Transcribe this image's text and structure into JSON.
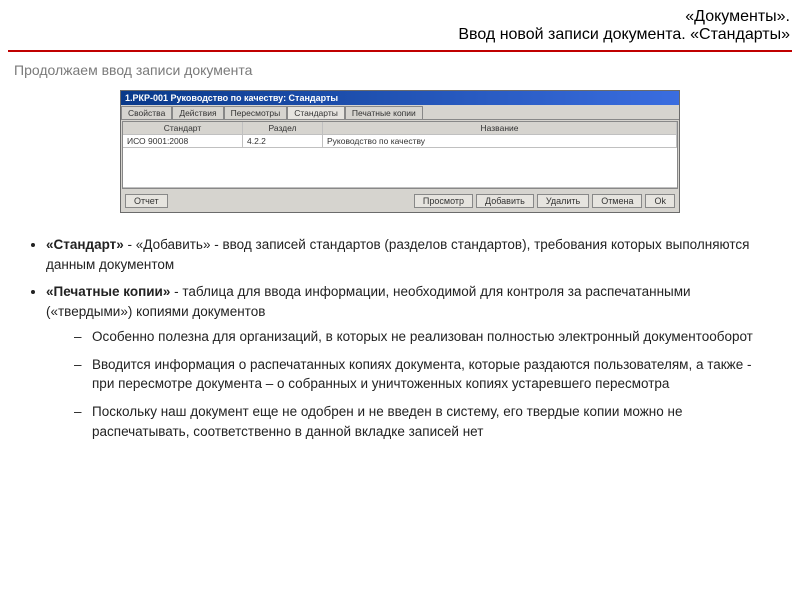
{
  "header": {
    "line1": "«Документы».",
    "line2": "Ввод новой записи документа. «Стандарты»"
  },
  "subtitle": "Продолжаем ввод записи документа",
  "window": {
    "title": "1.РКР-001 Руководство по качеству: Стандарты",
    "tabs": [
      "Свойства",
      "Действия",
      "Пересмотры",
      "Стандарты",
      "Печатные копии"
    ],
    "activeTab": 3,
    "columns": [
      "Стандарт",
      "Раздел",
      "Название"
    ],
    "row": {
      "standard": "ИСО 9001:2008",
      "section": "4.2.2",
      "name": "Руководство по качеству"
    },
    "btnLeft": "Отчет",
    "btnsRight": [
      "Просмотр",
      "Добавить",
      "Удалить",
      "Отмена",
      "Ok"
    ]
  },
  "body": {
    "p1_bold": "«Стандарт»",
    "p1_rest": " - «Добавить» - ввод записей стандартов (разделов стандартов), требования которых выполняются данным документом",
    "p2_bold": "«Печатные копии»",
    "p2_rest": " - таблица для ввода информации, необходимой для контроля за распечатанными («твердыми») копиями документов",
    "sub1": "Особенно полезна для организаций, в которых не реализован полностью электронный документооборот",
    "sub2": "Вводится информация о распечатанных копиях документа, которые раздаются пользователям, а также  - при пересмотре документа – о собранных и уничтоженных копиях устаревшего пересмотра",
    "sub3": "Поскольку наш документ еще не одобрен и не введен в систему, его твердые копии можно не распечатывать, соответственно в данной вкладке записей нет"
  }
}
